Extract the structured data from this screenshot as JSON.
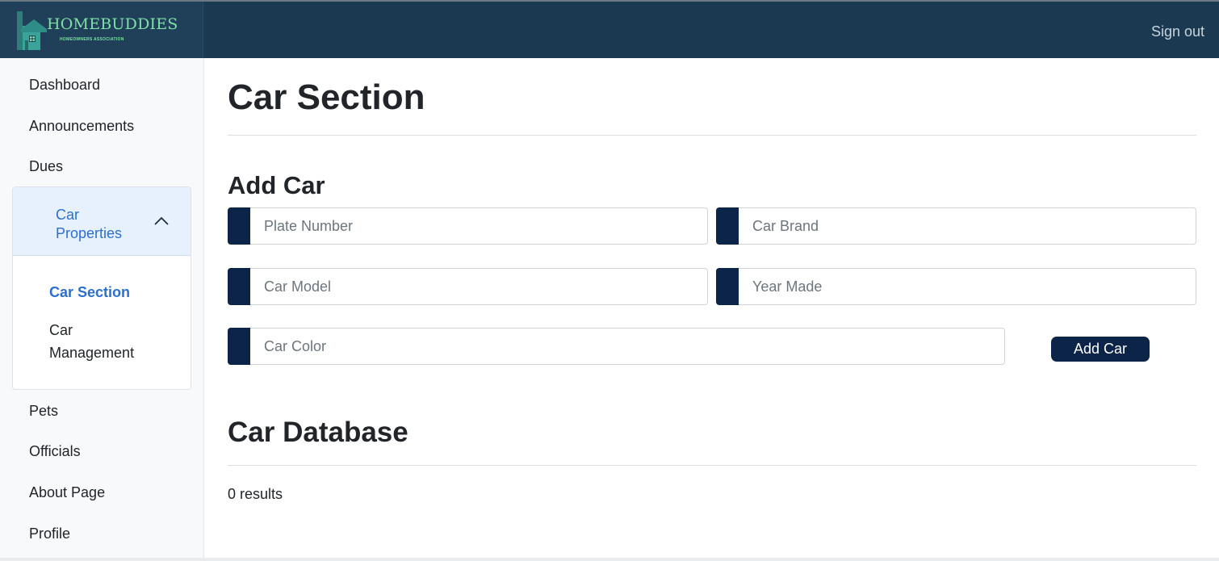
{
  "brand": {
    "title": "HOMEBUDDIES",
    "subtitle": "HOMEOWNERS ASSOCIATION"
  },
  "header": {
    "signout_label": "Sign out"
  },
  "sidebar": {
    "items_top": [
      "Dashboard",
      "Announcements",
      "Dues"
    ],
    "group": {
      "label": "Car Properties",
      "expanded": true,
      "children": [
        {
          "label": "Car Section",
          "active": true
        },
        {
          "label": "Car Management",
          "active": false
        }
      ]
    },
    "items_bottom": [
      "Pets",
      "Officials",
      "About Page",
      "Profile"
    ]
  },
  "main": {
    "title": "Car Section",
    "add_section_title": "Add Car",
    "fields": {
      "plate": {
        "placeholder": "Plate Number",
        "value": ""
      },
      "brand": {
        "placeholder": "Car Brand",
        "value": ""
      },
      "model": {
        "placeholder": "Car Model",
        "value": ""
      },
      "year": {
        "placeholder": "Year Made",
        "value": ""
      },
      "color": {
        "placeholder": "Car Color",
        "value": ""
      }
    },
    "add_button_label": "Add Car",
    "database_title": "Car Database",
    "results_text": "0 results"
  },
  "colors": {
    "topbar": "#1b3a52",
    "accent": "#0b2447",
    "active_link": "#2b6fcf",
    "brand_green": "#7fe0a8"
  },
  "icons": {
    "logo": "house-buildings-icon",
    "group_toggle": "chevron-up-icon"
  }
}
